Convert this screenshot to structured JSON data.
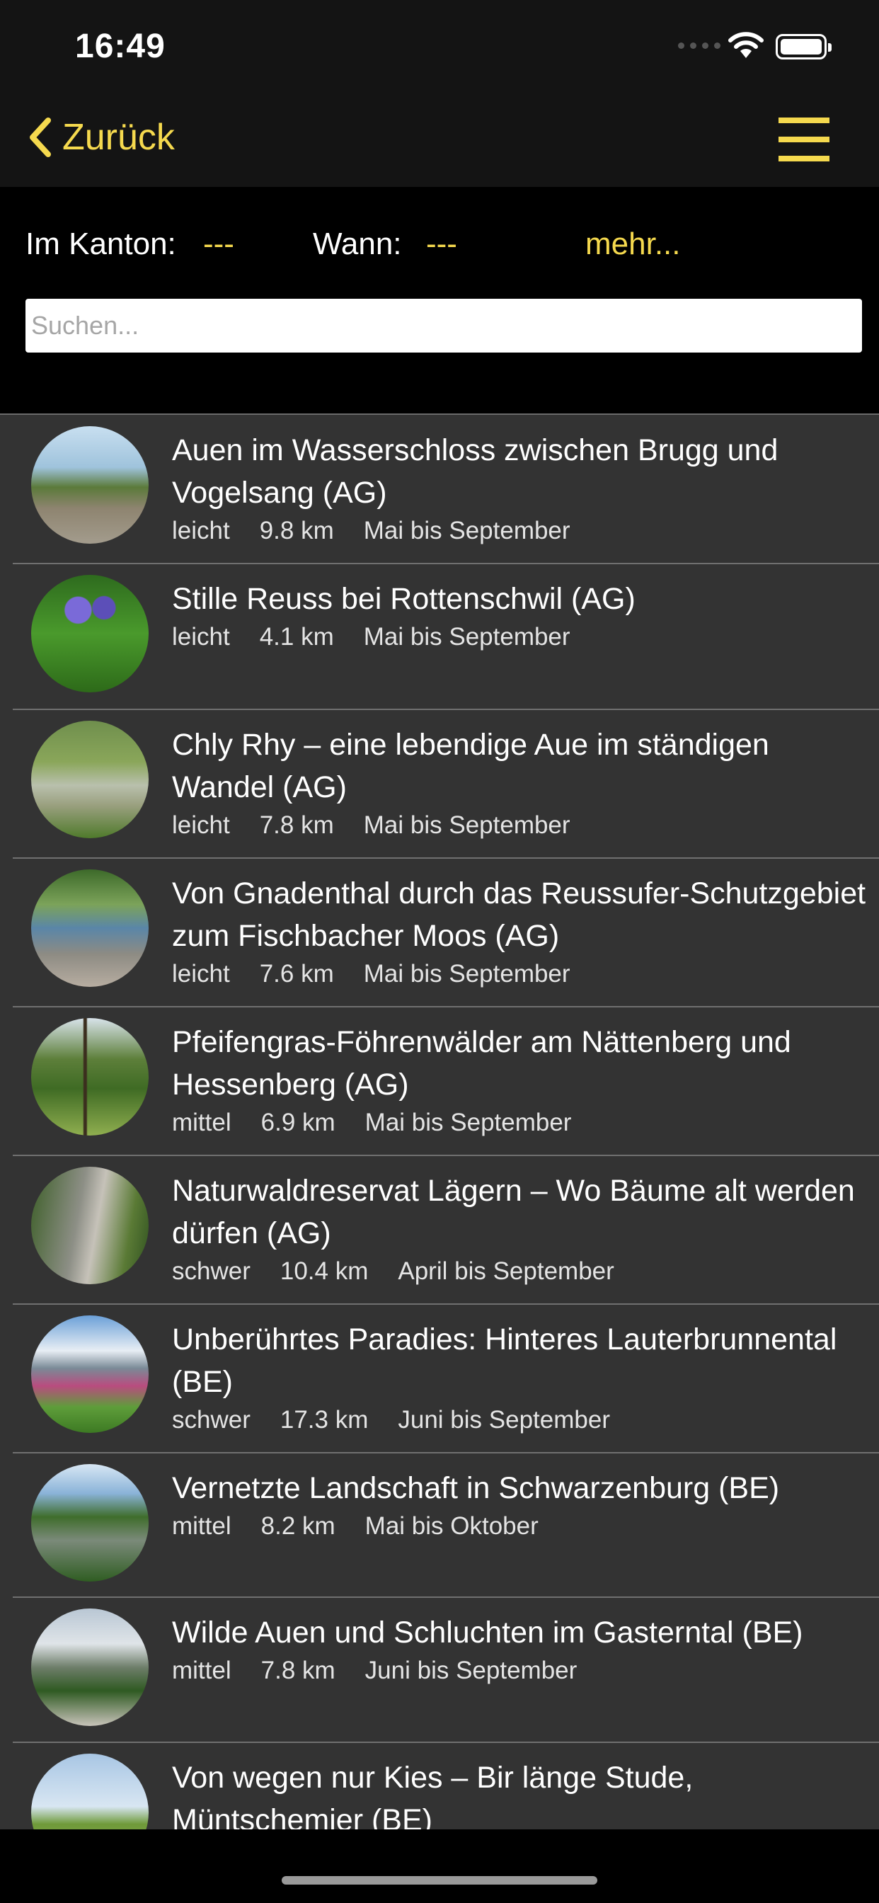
{
  "status": {
    "time": "16:49"
  },
  "nav": {
    "back_label": "Zurück"
  },
  "filter": {
    "kanton_label": "Im Kanton:",
    "kanton_value": "---",
    "wann_label": "Wann:",
    "wann_value": "---",
    "more_label": "mehr...",
    "search_placeholder": "Suchen..."
  },
  "colors": {
    "accent": "#f5d94e",
    "list_bg": "#333333",
    "bar_bg": "#141414"
  },
  "routes": [
    {
      "title": "Auen im Wasserschloss zwischen Brugg und Vogelsang (AG)",
      "difficulty": "leicht",
      "distance": "9.8 km",
      "season": "Mai bis September",
      "thumb_icon": "river-meadow-photo"
    },
    {
      "title": "Stille Reuss bei Rottenschwil (AG)",
      "difficulty": "leicht",
      "distance": "4.1 km",
      "season": "Mai bis September",
      "thumb_icon": "iris-flower-photo"
    },
    {
      "title": "Chly Rhy – eine lebendige Aue im ständigen Wandel (AG)",
      "difficulty": "leicht",
      "distance": "7.8 km",
      "season": "Mai bis September",
      "thumb_icon": "wetland-photo"
    },
    {
      "title": "Von Gnadenthal durch das Reussufer-Schutzgebiet zum Fischbacher Moos (AG)",
      "difficulty": "leicht",
      "distance": "7.6 km",
      "season": "Mai bis September",
      "thumb_icon": "river-bank-photo"
    },
    {
      "title": "Pfeifengras-Föhrenwälder am Nättenberg und Hessenberg (AG)",
      "difficulty": "mittel",
      "distance": "6.9 km",
      "season": "Mai bis September",
      "thumb_icon": "pine-forest-photo"
    },
    {
      "title": "Naturwaldreservat Lägern – Wo Bäume alt werden dürfen (AG)",
      "difficulty": "schwer",
      "distance": "10.4 km",
      "season": "April bis September",
      "thumb_icon": "rock-ridge-photo"
    },
    {
      "title": "Unberührtes Paradies: Hinteres Lauterbrunnental (BE)",
      "difficulty": "schwer",
      "distance": "17.3 km",
      "season": "Juni bis September",
      "thumb_icon": "alpine-flowers-photo"
    },
    {
      "title": "Vernetzte Landschaft in Schwarzenburg (BE)",
      "difficulty": "mittel",
      "distance": "8.2 km",
      "season": "Mai bis Oktober",
      "thumb_icon": "gorge-aerial-photo"
    },
    {
      "title": "Wilde Auen und Schluchten im Gasterntal (BE)",
      "difficulty": "mittel",
      "distance": "7.8 km",
      "season": "Juni bis September",
      "thumb_icon": "mountain-valley-photo"
    },
    {
      "title": "Von wegen nur Kies – Bir länge Stude, Müntschemier (BE)",
      "difficulty": "",
      "distance": "",
      "season": "",
      "thumb_icon": "field-landscape-photo"
    }
  ]
}
